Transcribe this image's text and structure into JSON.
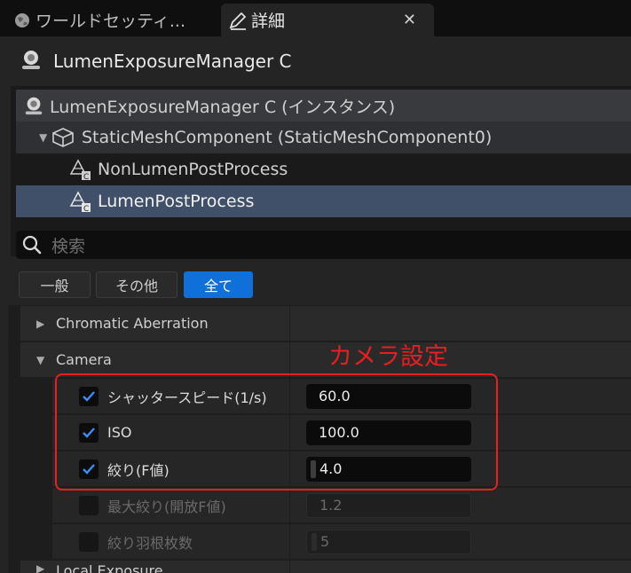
{
  "tabs": [
    {
      "label": "ワールドセッティ...",
      "icon": "globe-icon",
      "active": false
    },
    {
      "label": "詳細",
      "icon": "pencil-icon",
      "active": true,
      "close": "✕"
    }
  ],
  "object_title": "LumenExposureManager C",
  "tree": [
    {
      "label": "LumenExposureManager C (インスタンス)",
      "icon": "actor-icon"
    },
    {
      "label": "StaticMeshComponent (StaticMeshComponent0)",
      "icon": "static-mesh-icon",
      "expanded": true
    },
    {
      "label": "NonLumenPostProcess",
      "icon": "post-process-component-icon"
    },
    {
      "label": "LumenPostProcess",
      "icon": "post-process-component-icon",
      "selected": true
    }
  ],
  "search": {
    "placeholder": "検索"
  },
  "filters": [
    "一般",
    "その他",
    "全て"
  ],
  "categories": {
    "chromatic": "Chromatic Aberration",
    "camera": "Camera",
    "lens": "Local Exposure"
  },
  "properties": [
    {
      "name": "シャッタースピード(1/s)",
      "value": "60.0",
      "checked": true
    },
    {
      "name": "ISO",
      "value": "100.0",
      "checked": true
    },
    {
      "name": "絞り(F値)",
      "value": "4.0",
      "checked": true
    },
    {
      "name": "最大絞り(開放F値)",
      "value": "1.2",
      "checked": false
    },
    {
      "name": "絞り羽根枚数",
      "value": "5",
      "checked": false
    }
  ],
  "annotation": "カメラ設定",
  "colors": {
    "accent": "#0e70d8",
    "selection": "#3f5068",
    "annotation": "#e81f1f"
  }
}
